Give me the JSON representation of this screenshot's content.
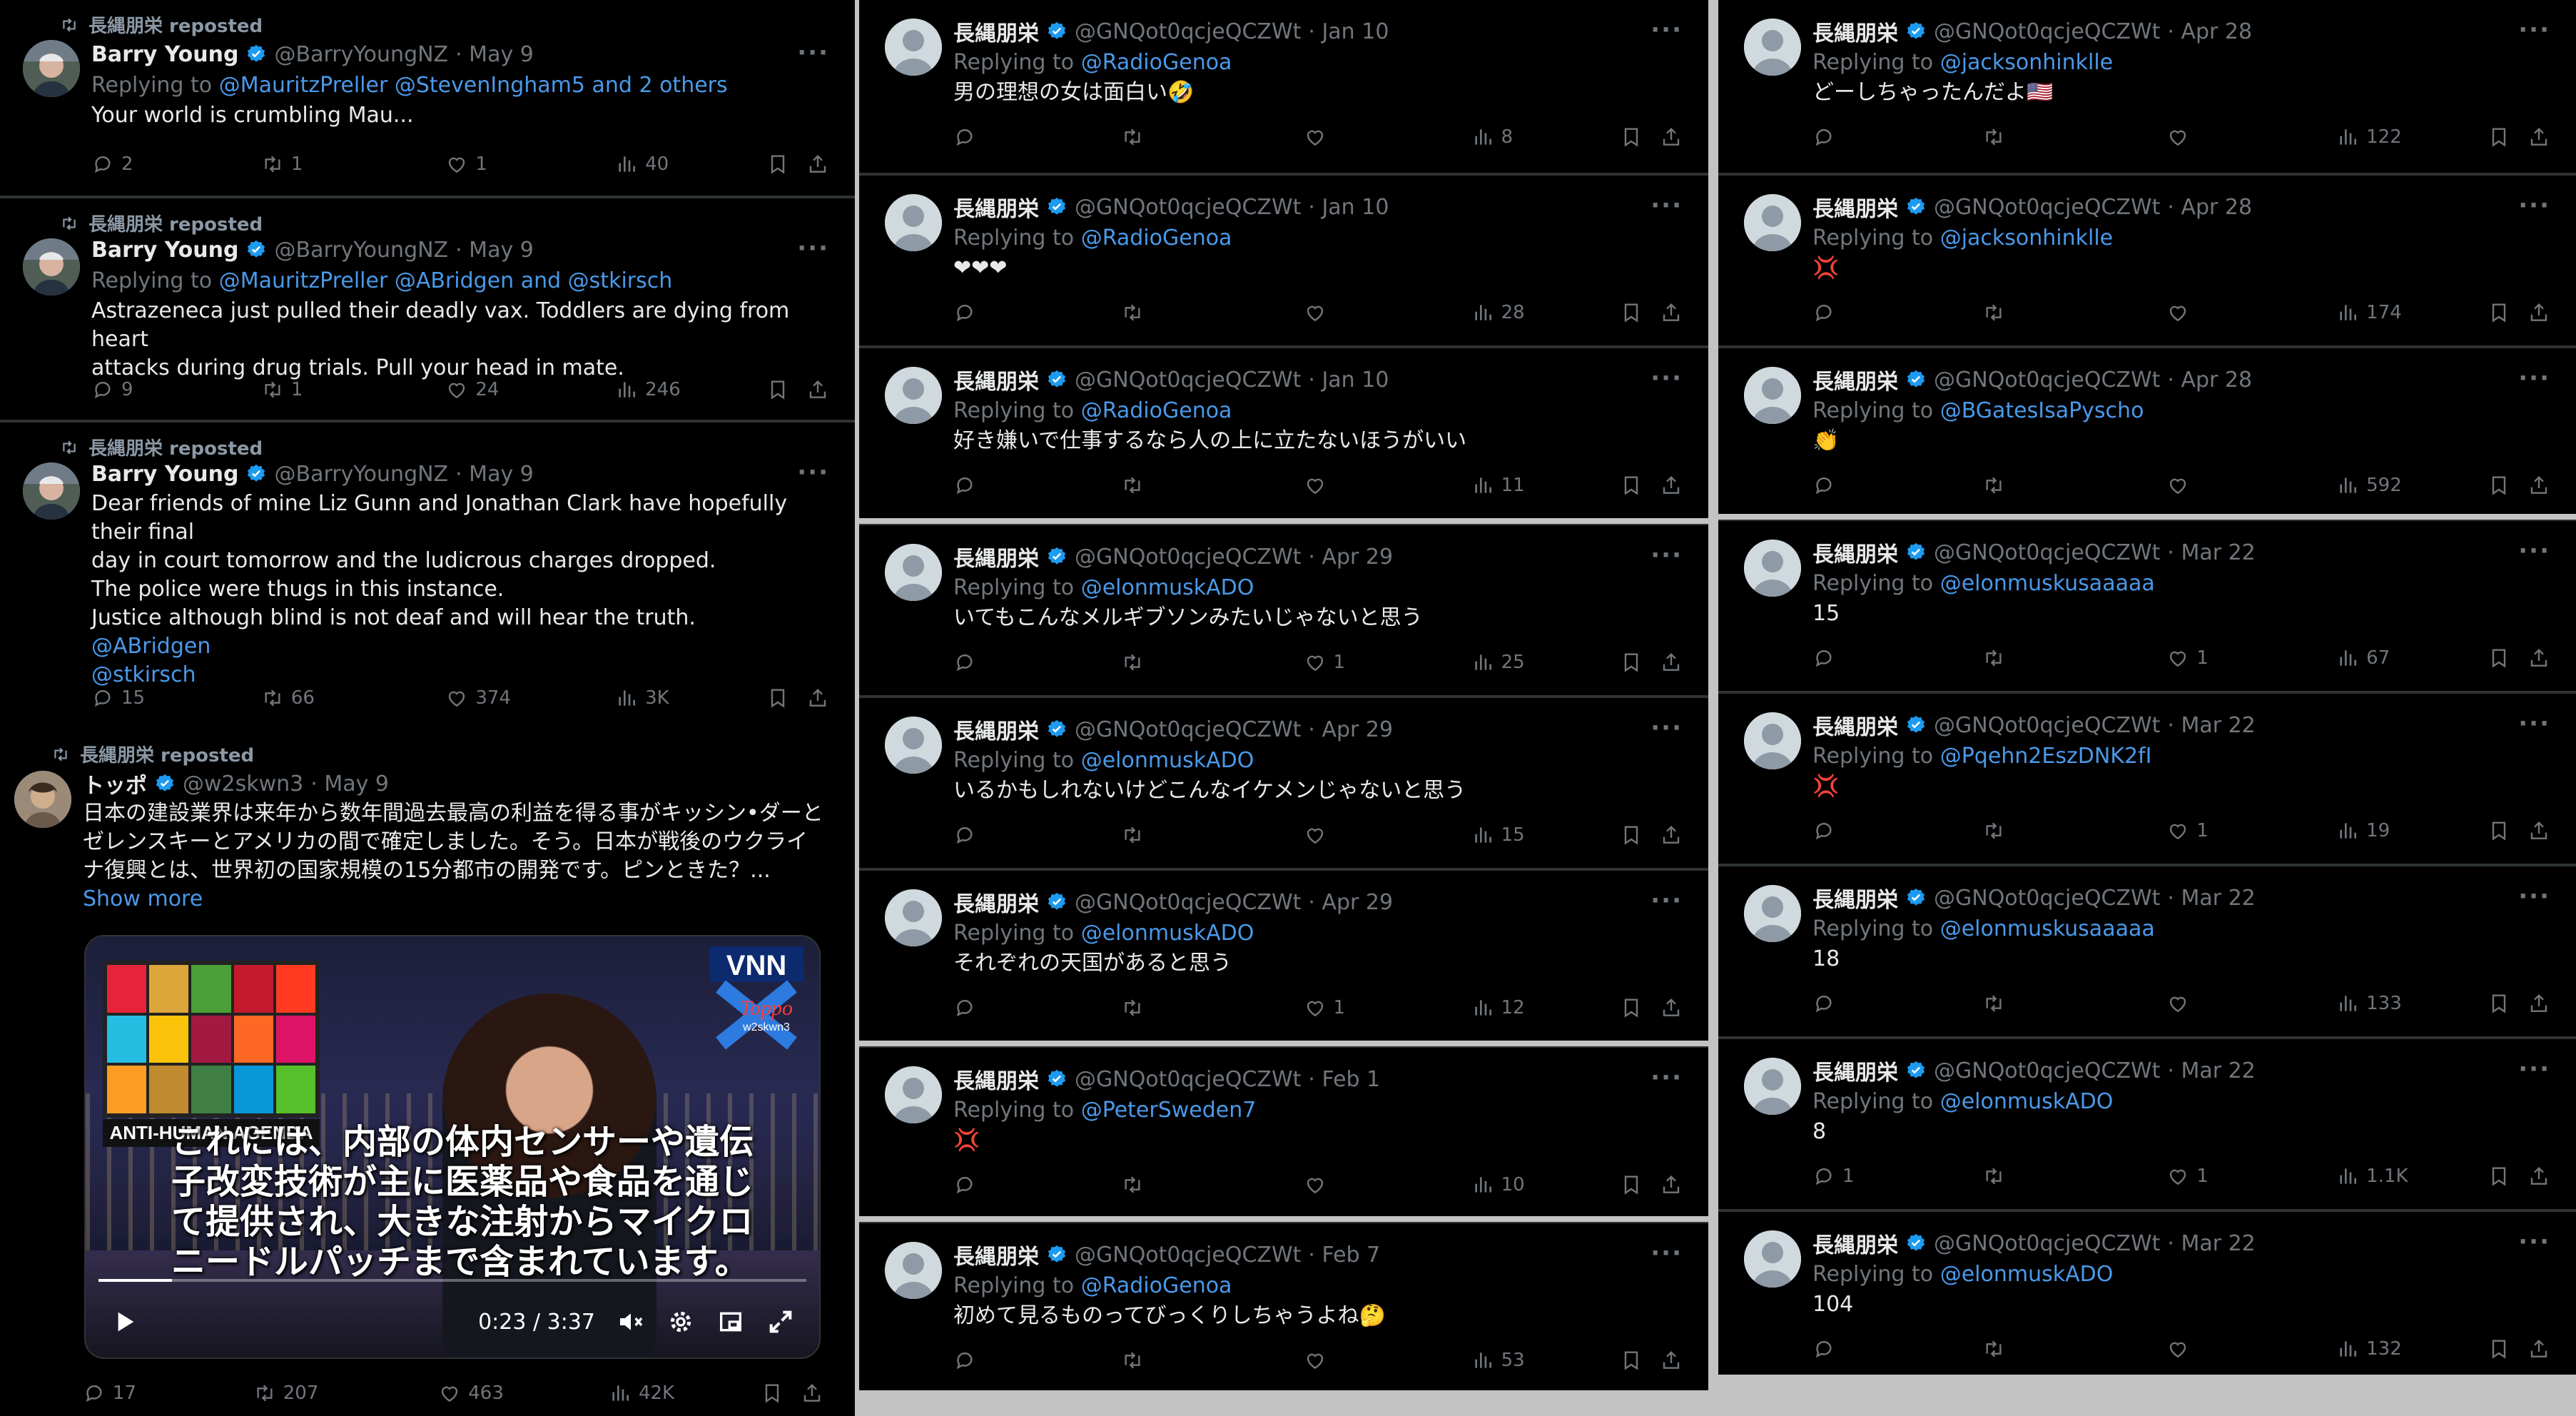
{
  "colors": {
    "accent": "#1d9bf0",
    "mention": "#4a99e9",
    "muted": "#71767b",
    "background": "#000000"
  },
  "icons": [
    "repost-icon",
    "verified-icon",
    "more-icon",
    "reply-icon",
    "retweet-icon",
    "like-icon",
    "views-icon",
    "bookmark-icon",
    "share-icon",
    "play-icon",
    "mute-icon",
    "settings-icon",
    "pip-icon",
    "fullscreen-icon"
  ],
  "left": {
    "tweets": [
      {
        "reposted_by": "長縄朋栄 reposted",
        "name": "Barry Young",
        "handle": "@BarryYoungNZ",
        "date": "· May 9",
        "replying_prefix": "Replying to",
        "replying_to": "@MauritzPreller @StevenIngham5 and 2 others",
        "lines": [
          "Your world is crumbling Mau..."
        ],
        "stats": {
          "replies": "2",
          "retweets": "1",
          "likes": "1",
          "views": "40"
        }
      },
      {
        "reposted_by": "長縄朋栄 reposted",
        "name": "Barry Young",
        "handle": "@BarryYoungNZ",
        "date": "· May 9",
        "replying_prefix": "Replying to",
        "replying_to": "@MauritzPreller @ABridgen and @stkirsch",
        "lines": [
          "Astrazeneca just pulled their deadly vax. Toddlers are dying from heart",
          "attacks during drug trials. Pull your head in mate."
        ],
        "stats": {
          "replies": "9",
          "retweets": "1",
          "likes": "24",
          "views": "246"
        }
      },
      {
        "reposted_by": "長縄朋栄 reposted",
        "name": "Barry Young",
        "handle": "@BarryYoungNZ",
        "date": "· May 9",
        "lines": [
          "Dear friends of mine Liz Gunn and Jonathan Clark have hopefully their final",
          "day in court tomorrow and the ludicrous charges dropped.",
          "The police were thugs in this instance.",
          "Justice although blind is not deaf and will hear the truth."
        ],
        "links": [
          "@ABridgen",
          "@stkirsch"
        ],
        "stats": {
          "replies": "15",
          "retweets": "66",
          "likes": "374",
          "views": "3K"
        }
      },
      {
        "reposted_by": "長縄朋栄 reposted",
        "name": "トッポ",
        "handle": "@w2skwn3",
        "date": "· May 9",
        "lines": [
          "日本の建設業界は来年から数年間過去最高の利益を得る事がキッシン•ダーと",
          "ゼレンスキーとアメリカの間で確定しました。そう。日本が戦後のウクライ",
          "ナ復興とは、世界初の国家規模の15分都市の開発です。ピンときた？..."
        ],
        "show_more": "Show more",
        "video": {
          "badge": "ANTI-HUMAN AGENDA",
          "logo": "VNN",
          "watermark": "Toppo",
          "watermark_handle": "w2skwn3",
          "subtitle_lines": [
            "これには、内部の体内センサーや遺伝",
            "子改変技術が主に医薬品や食品を通じ",
            "て提供され、大きな注射からマイクロ",
            "ニードルパッチまで含まれています。"
          ],
          "time": "0:23 / 3:37",
          "progress": 0.104
        },
        "stats": {
          "replies": "17",
          "retweets": "207",
          "likes": "463",
          "views": "42K"
        }
      }
    ]
  },
  "middle": {
    "tweets": [
      {
        "name": "長縄朋栄",
        "handle": "@GNQot0qcjeQCZWt",
        "date": "· Jan 10",
        "replying_prefix": "Replying to",
        "replying_to": "@RadioGenoa",
        "text": "男の理想の女は面白い🤣",
        "stats": {
          "replies": "",
          "retweets": "",
          "likes": "",
          "views": "8"
        }
      },
      {
        "name": "長縄朋栄",
        "handle": "@GNQot0qcjeQCZWt",
        "date": "· Jan 10",
        "replying_prefix": "Replying to",
        "replying_to": "@RadioGenoa",
        "text": "❤❤❤",
        "stats": {
          "replies": "",
          "retweets": "",
          "likes": "",
          "views": "28"
        }
      },
      {
        "name": "長縄朋栄",
        "handle": "@GNQot0qcjeQCZWt",
        "date": "· Jan 10",
        "replying_prefix": "Replying to",
        "replying_to": "@RadioGenoa",
        "text": "好き嫌いで仕事するなら人の上に立たないほうがいい",
        "stats": {
          "replies": "",
          "retweets": "",
          "likes": "",
          "views": "11"
        }
      },
      {
        "name": "長縄朋栄",
        "handle": "@GNQot0qcjeQCZWt",
        "date": "· Apr 29",
        "replying_prefix": "Replying to",
        "replying_to": "@elonmuskADO",
        "text": "いてもこんなメルギブソンみたいじゃないと思う",
        "stats": {
          "replies": "",
          "retweets": "",
          "likes": "1",
          "views": "25"
        }
      },
      {
        "name": "長縄朋栄",
        "handle": "@GNQot0qcjeQCZWt",
        "date": "· Apr 29",
        "replying_prefix": "Replying to",
        "replying_to": "@elonmuskADO",
        "text": "いるかもしれないけどこんなイケメンじゃないと思う",
        "stats": {
          "replies": "",
          "retweets": "",
          "likes": "",
          "views": "15"
        }
      },
      {
        "name": "長縄朋栄",
        "handle": "@GNQot0qcjeQCZWt",
        "date": "· Apr 29",
        "replying_prefix": "Replying to",
        "replying_to": "@elonmuskADO",
        "text": "それぞれの天国があると思う",
        "stats": {
          "replies": "",
          "retweets": "",
          "likes": "1",
          "views": "12"
        }
      },
      {
        "name": "長縄朋栄",
        "handle": "@GNQot0qcjeQCZWt",
        "date": "· Feb 1",
        "replying_prefix": "Replying to",
        "replying_to": "@PeterSweden7",
        "text": "💢",
        "stats": {
          "replies": "",
          "retweets": "",
          "likes": "",
          "views": "10"
        }
      },
      {
        "name": "長縄朋栄",
        "handle": "@GNQot0qcjeQCZWt",
        "date": "· Feb 7",
        "replying_prefix": "Replying to",
        "replying_to": "@RadioGenoa",
        "text": "初めて見るものってびっくりしちゃうよね🤔",
        "stats": {
          "replies": "",
          "retweets": "",
          "likes": "",
          "views": "53"
        }
      }
    ]
  },
  "right": {
    "tweets": [
      {
        "name": "長縄朋栄",
        "handle": "@GNQot0qcjeQCZWt",
        "date": "· Apr 28",
        "replying_prefix": "Replying to",
        "replying_to": "@jacksonhinklle",
        "text": "どーしちゃったんだよ🇺🇸",
        "stats": {
          "replies": "",
          "retweets": "",
          "likes": "",
          "views": "122"
        }
      },
      {
        "name": "長縄朋栄",
        "handle": "@GNQot0qcjeQCZWt",
        "date": "· Apr 28",
        "replying_prefix": "Replying to",
        "replying_to": "@jacksonhinklle",
        "text": "💢",
        "stats": {
          "replies": "",
          "retweets": "",
          "likes": "",
          "views": "174"
        }
      },
      {
        "name": "長縄朋栄",
        "handle": "@GNQot0qcjeQCZWt",
        "date": "· Apr 28",
        "replying_prefix": "Replying to",
        "replying_to": "@BGatesIsaPyscho",
        "text": "👏",
        "stats": {
          "replies": "",
          "retweets": "",
          "likes": "",
          "views": "592"
        }
      },
      {
        "name": "長縄朋栄",
        "handle": "@GNQot0qcjeQCZWt",
        "date": "· Mar 22",
        "replying_prefix": "Replying to",
        "replying_to": "@elonmuskusaaaaa",
        "text": "15",
        "stats": {
          "replies": "",
          "retweets": "",
          "likes": "1",
          "views": "67"
        }
      },
      {
        "name": "長縄朋栄",
        "handle": "@GNQot0qcjeQCZWt",
        "date": "· Mar 22",
        "replying_prefix": "Replying to",
        "replying_to": "@Pqehn2EszDNK2fI",
        "text": "💢",
        "stats": {
          "replies": "",
          "retweets": "",
          "likes": "1",
          "views": "19"
        }
      },
      {
        "name": "長縄朋栄",
        "handle": "@GNQot0qcjeQCZWt",
        "date": "· Mar 22",
        "replying_prefix": "Replying to",
        "replying_to": "@elonmuskusaaaaa",
        "text": "18",
        "stats": {
          "replies": "",
          "retweets": "",
          "likes": "",
          "views": "133"
        }
      },
      {
        "name": "長縄朋栄",
        "handle": "@GNQot0qcjeQCZWt",
        "date": "· Mar 22",
        "replying_prefix": "Replying to",
        "replying_to": "@elonmuskADO",
        "text": "8",
        "stats": {
          "replies": "1",
          "retweets": "",
          "likes": "1",
          "views": "1.1K"
        }
      },
      {
        "name": "長縄朋栄",
        "handle": "@GNQot0qcjeQCZWt",
        "date": "· Mar 22",
        "replying_prefix": "Replying to",
        "replying_to": "@elonmuskADO",
        "text": "104",
        "stats": {
          "replies": "",
          "retweets": "",
          "likes": "",
          "views": "132"
        }
      }
    ]
  }
}
